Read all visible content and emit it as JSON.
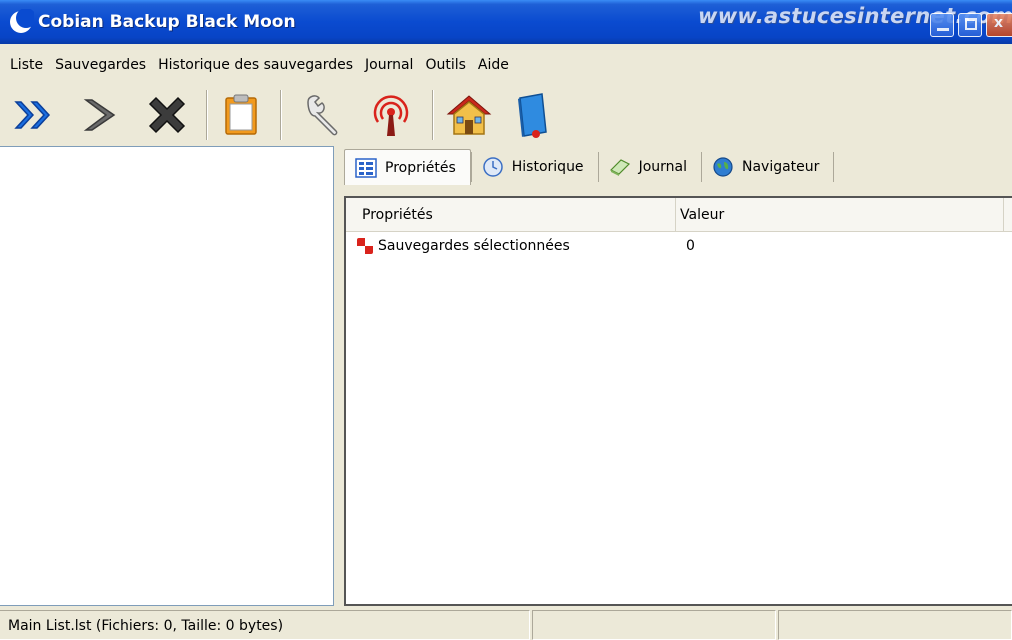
{
  "window": {
    "title": "Cobian Backup Black Moon",
    "watermark": "www.astucesinternet.com",
    "close_glyph": "x"
  },
  "menu": [
    "Liste",
    "Sauvegardes",
    "Historique des sauvegardes",
    "Journal",
    "Outils",
    "Aide"
  ],
  "toolbar": {
    "icons": [
      "run-all-icon",
      "run-selected-icon",
      "cancel-icon",
      "clipboard-icon",
      "wrench-icon",
      "antenna-icon",
      "home-icon",
      "help-book-icon"
    ]
  },
  "tabs": [
    {
      "label": "Propriétés",
      "icon": "properties-icon",
      "active": true
    },
    {
      "label": "Historique",
      "icon": "clock-icon",
      "active": false
    },
    {
      "label": "Journal",
      "icon": "journal-icon",
      "active": false
    },
    {
      "label": "Navigateur",
      "icon": "globe-icon",
      "active": false
    }
  ],
  "properties": {
    "columns": [
      "Propriétés",
      "Valeur"
    ],
    "rows": [
      {
        "name": "Sauvegardes sélectionnées",
        "value": "0",
        "icon": "selection-icon"
      }
    ]
  },
  "status": {
    "main": "Main List.lst (Fichiers: 0, Taille: 0 bytes)",
    "pane2": "",
    "pane3": ""
  },
  "colors": {
    "titlebar": "#0a4bd0",
    "arrow_blue": "#1a6ee0",
    "background": "#ece9d8"
  }
}
